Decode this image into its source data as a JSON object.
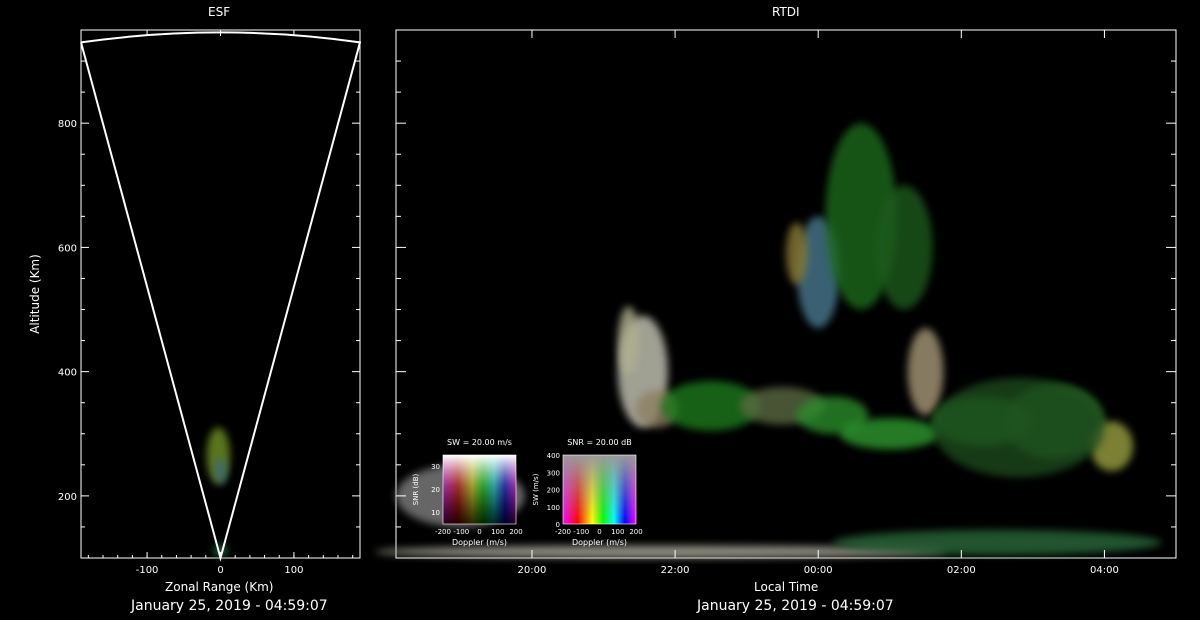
{
  "chart_data": [
    {
      "type": "scatter",
      "title": "ESF",
      "xlabel": "Zonal Range (Km)",
      "ylabel": "Altitude (Km)",
      "xlim": [
        -190,
        190
      ],
      "ylim": [
        100,
        950
      ],
      "xticks": [
        -100,
        0,
        100
      ],
      "yticks": [
        200,
        400,
        600,
        800
      ],
      "fan": {
        "apex": [
          0,
          100
        ],
        "left_top": [
          -190,
          930
        ],
        "right_top": [
          190,
          930
        ]
      },
      "echoes": [
        {
          "x": -3,
          "y": 265,
          "halfwidth": 16,
          "halfheight": 45,
          "color": "#6b8a20"
        },
        {
          "x": 0,
          "y": 240,
          "halfwidth": 8,
          "halfheight": 22,
          "color": "#3a6a78"
        },
        {
          "x": 0,
          "y": 112,
          "halfwidth": 10,
          "halfheight": 10,
          "color": "#1e6a3a"
        }
      ],
      "timestamp": "January 25, 2019 - 04:59:07"
    },
    {
      "type": "scatter",
      "title": "RTDI",
      "xlabel": "Local Time",
      "ylabel": "Altitude (Km)",
      "xlim": [
        18.1,
        5.0
      ],
      "x_is_hours_wrapping_midnight": true,
      "ylim": [
        100,
        950
      ],
      "xticks": [
        "20:00",
        "22:00",
        "00:00",
        "02:00",
        "04:00"
      ],
      "yticks": [
        200,
        400,
        600,
        800
      ],
      "echo_blobs": [
        {
          "t": 21.55,
          "alt": 400,
          "dt": 0.35,
          "dalt": 90,
          "color": "#c8c8b8"
        },
        {
          "t": 21.35,
          "alt": 450,
          "dt": 0.15,
          "dalt": 55,
          "color": "#b0b090"
        },
        {
          "t": 21.75,
          "alt": 340,
          "dt": 0.3,
          "dalt": 30,
          "color": "#8c8060"
        },
        {
          "t": 22.5,
          "alt": 345,
          "dt": 0.7,
          "dalt": 40,
          "color": "#1f7a1f"
        },
        {
          "t": 23.5,
          "alt": 345,
          "dt": 0.6,
          "dalt": 30,
          "color": "#5a6a40"
        },
        {
          "t": 24.2,
          "alt": 330,
          "dt": 0.5,
          "dalt": 30,
          "color": "#2a8c2a"
        },
        {
          "t": 25.0,
          "alt": 300,
          "dt": 0.7,
          "dalt": 25,
          "color": "#2f9a2f"
        },
        {
          "t": 25.5,
          "alt": 400,
          "dt": 0.25,
          "dalt": 70,
          "color": "#a89a78"
        },
        {
          "t": 26.3,
          "alt": 320,
          "dt": 0.7,
          "dalt": 40,
          "color": "#258a25"
        },
        {
          "t": 27.3,
          "alt": 320,
          "dt": 0.7,
          "dalt": 60,
          "color": "#2a7a2a"
        },
        {
          "t": 28.1,
          "alt": 280,
          "dt": 0.3,
          "dalt": 40,
          "color": "#9aa040"
        },
        {
          "t": 24.0,
          "alt": 560,
          "dt": 0.3,
          "dalt": 90,
          "color": "#4a7a90"
        },
        {
          "t": 23.7,
          "alt": 590,
          "dt": 0.15,
          "dalt": 50,
          "color": "#8a7a30"
        },
        {
          "t": 24.6,
          "alt": 650,
          "dt": 0.5,
          "dalt": 150,
          "color": "#1e6a1e"
        },
        {
          "t": 25.2,
          "alt": 600,
          "dt": 0.4,
          "dalt": 100,
          "color": "#1a5a1a"
        },
        {
          "t": 26.8,
          "alt": 310,
          "dt": 1.2,
          "dalt": 80,
          "color": "#1a4a1a"
        },
        {
          "t": 19.0,
          "alt": 200,
          "dt": 0.9,
          "dalt": 50,
          "color": "#808080"
        },
        {
          "t": 21.8,
          "alt": 110,
          "dt": 4.0,
          "dalt": 10,
          "color": "#b0b0a0"
        },
        {
          "t": 26.5,
          "alt": 125,
          "dt": 2.3,
          "dalt": 20,
          "color": "#2a6a3a"
        }
      ],
      "colorbars": [
        {
          "title": "SW = 20.00 m/s",
          "xlabel": "Doppler (m/s)",
          "ylabel": "SNR (dB)",
          "xticks": [
            "-200",
            "-100",
            "0",
            "100",
            "200"
          ],
          "yticks": [
            "10",
            "20",
            "30"
          ]
        },
        {
          "title": "SNR = 20.00 dB",
          "xlabel": "Doppler (m/s)",
          "ylabel": "SW (m/s)",
          "xticks": [
            "-200",
            "-100",
            "0",
            "100",
            "200"
          ],
          "yticks": [
            "0",
            "100",
            "200",
            "300",
            "400"
          ]
        }
      ],
      "timestamp": "January 25, 2019 - 04:59:07"
    }
  ],
  "colors": {
    "background": "#000000",
    "axes": "#ffffff"
  }
}
